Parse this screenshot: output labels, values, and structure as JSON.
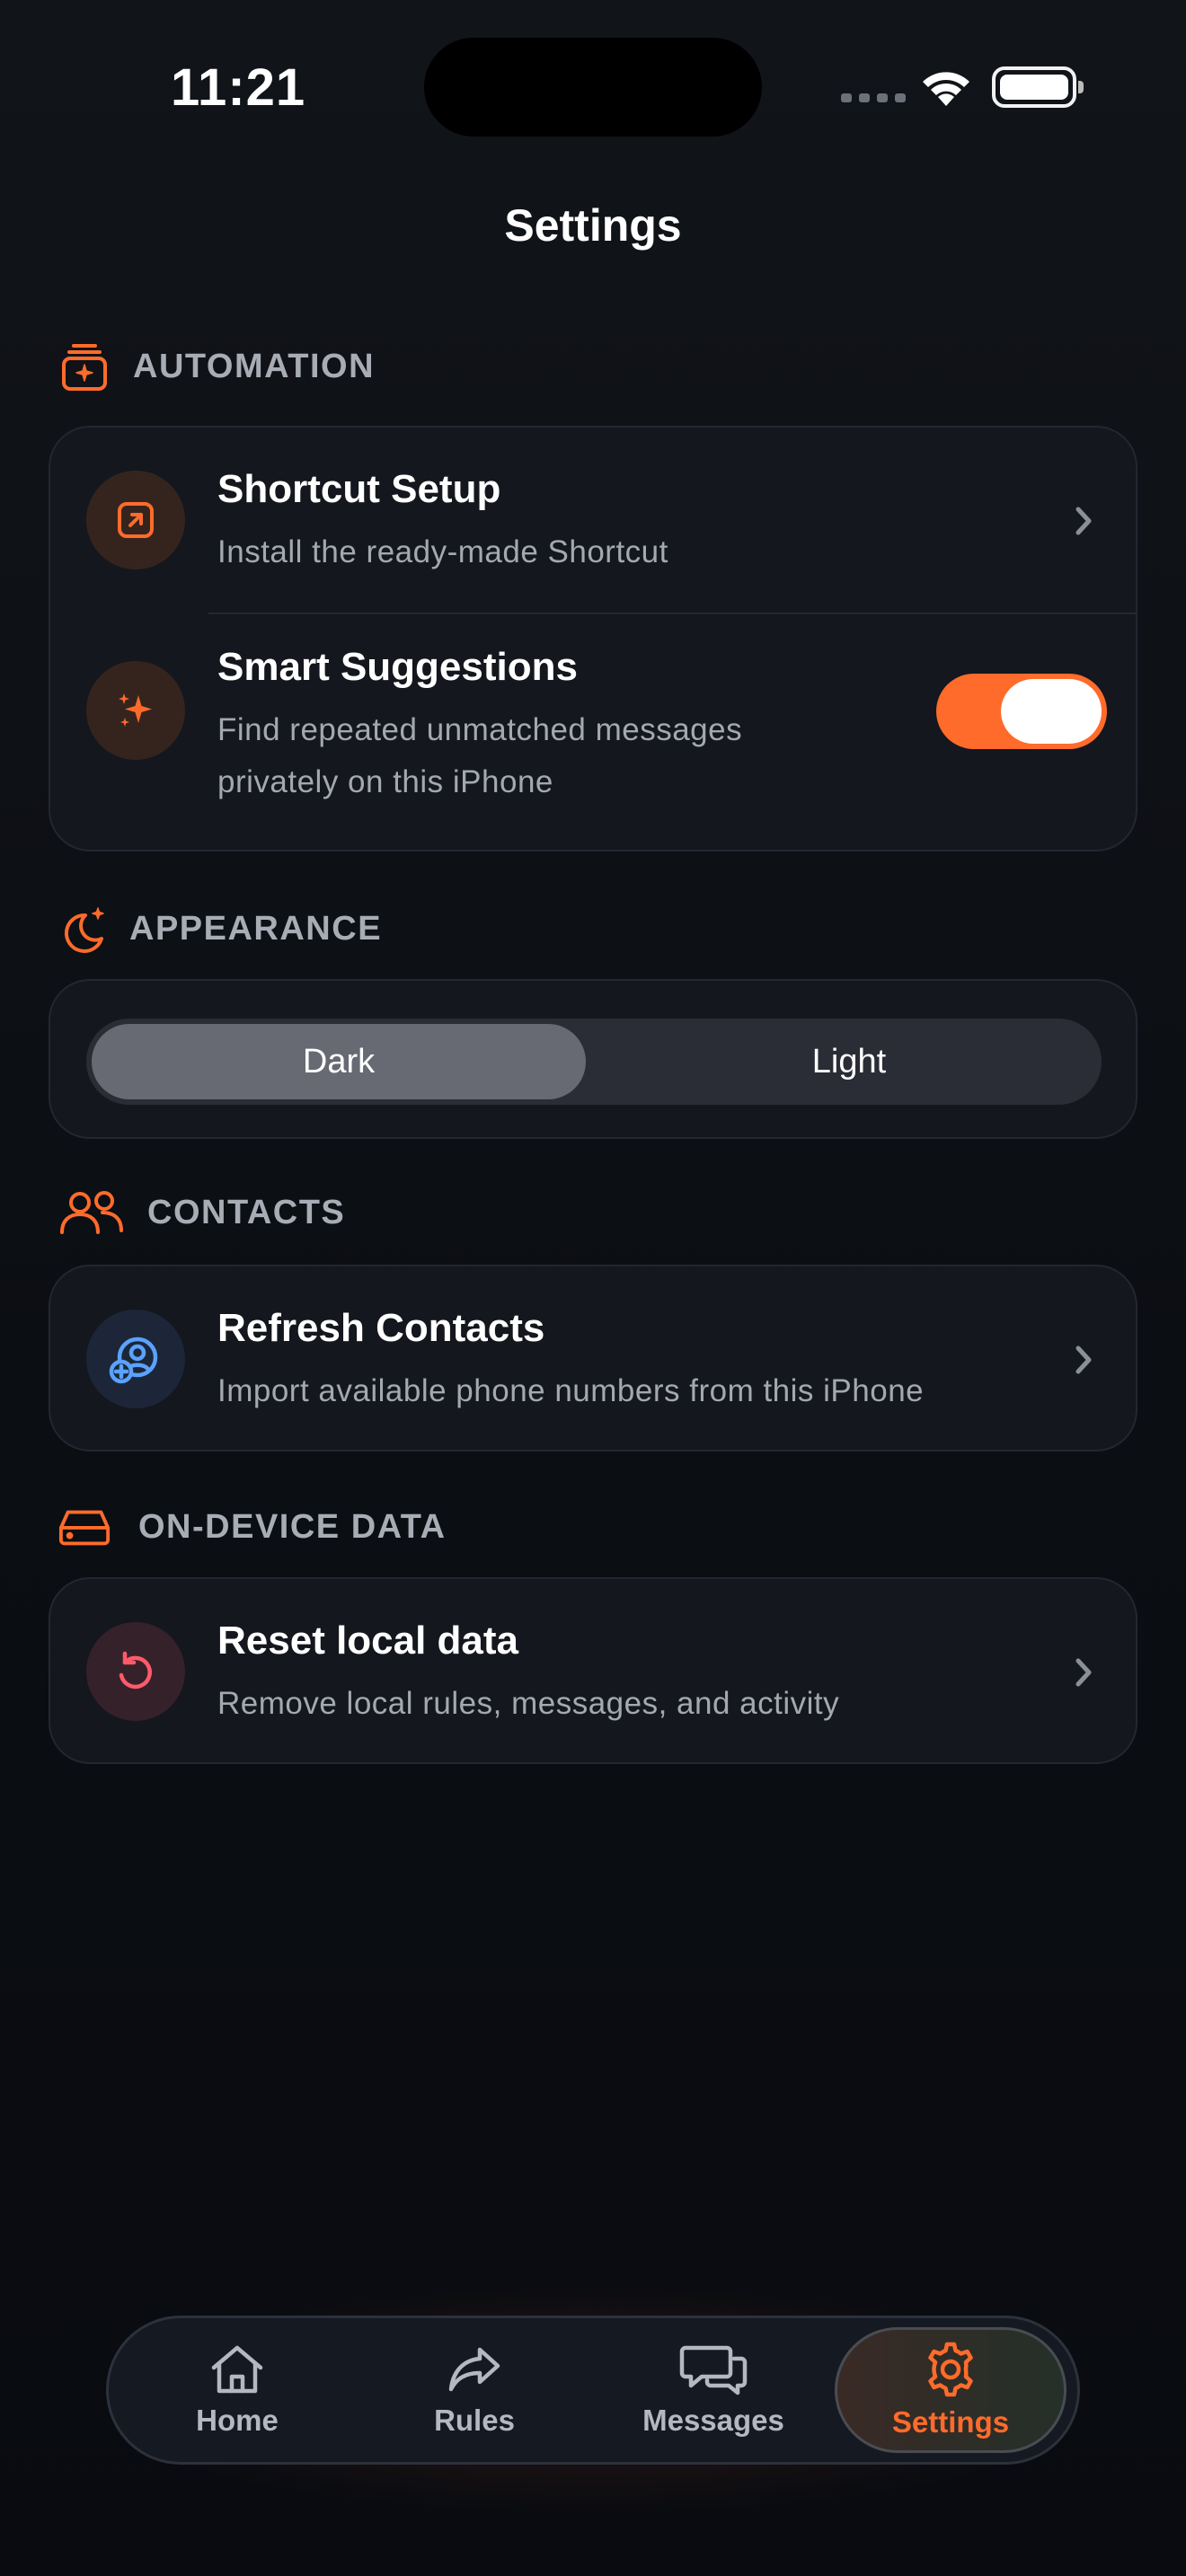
{
  "status": {
    "time": "11:21"
  },
  "page_title": "Settings",
  "colors": {
    "accent": "#ff6b2b",
    "card": "#14171d",
    "muted": "#a3a8b1",
    "danger": "#ff5a6a",
    "info": "#5aa2ff"
  },
  "sections": {
    "automation": {
      "label": "AUTOMATION",
      "icon": "sparkle-stack-icon",
      "rows": [
        {
          "title": "Shortcut Setup",
          "subtitle": "Install the ready-made Shortcut",
          "icon": "open-external-icon"
        },
        {
          "title": "Smart Suggestions",
          "subtitle_line1": "Find repeated unmatched messages",
          "subtitle_line2": "privately on this iPhone",
          "icon": "sparkles-icon",
          "toggle_on": true
        }
      ]
    },
    "appearance": {
      "label": "APPEARANCE",
      "icon": "moon-stars-icon",
      "options": [
        "Dark",
        "Light"
      ],
      "selected": "Dark"
    },
    "contacts": {
      "label": "CONTACTS",
      "icon": "people-icon",
      "row": {
        "title": "Refresh Contacts",
        "subtitle": "Import available phone numbers from this iPhone",
        "icon": "person-add-icon"
      }
    },
    "data": {
      "label": "ON-DEVICE DATA",
      "icon": "drive-icon",
      "row": {
        "title": "Reset local data",
        "subtitle": "Remove local rules, messages, and activity",
        "icon": "reset-icon"
      }
    }
  },
  "tabs": [
    {
      "label": "Home",
      "icon": "house-icon"
    },
    {
      "label": "Rules",
      "icon": "share-arrow-icon"
    },
    {
      "label": "Messages",
      "icon": "chat-bubbles-icon"
    },
    {
      "label": "Settings",
      "icon": "gear-icon",
      "active": true
    }
  ]
}
